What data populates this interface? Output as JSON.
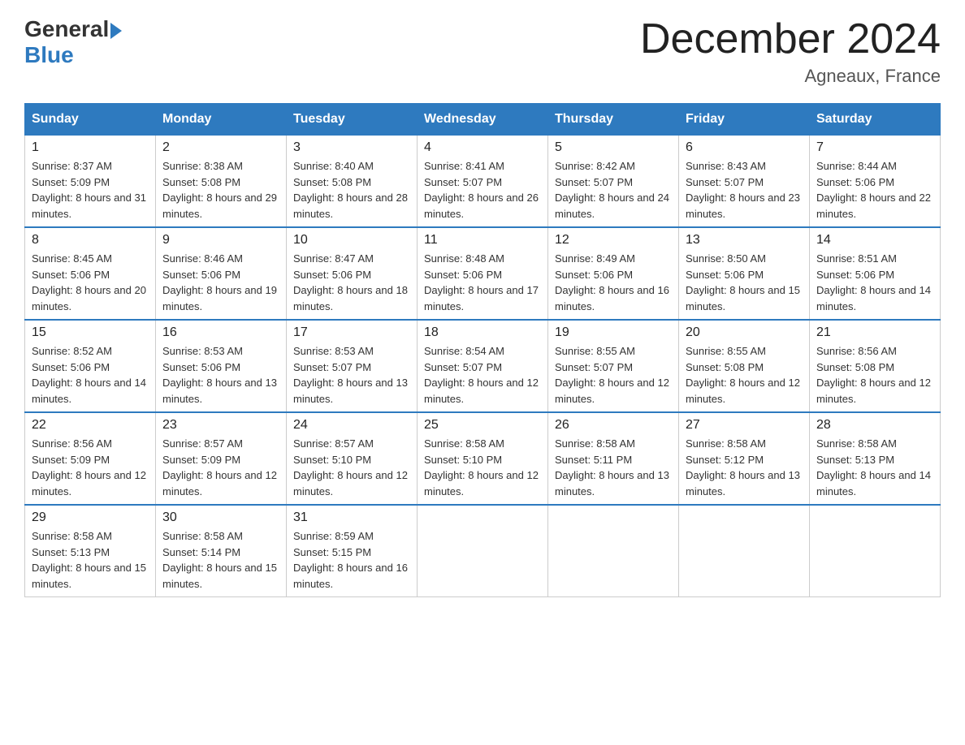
{
  "header": {
    "logo_general": "General",
    "logo_blue": "Blue",
    "month_title": "December 2024",
    "location": "Agneaux, France"
  },
  "weekdays": [
    "Sunday",
    "Monday",
    "Tuesday",
    "Wednesday",
    "Thursday",
    "Friday",
    "Saturday"
  ],
  "weeks": [
    [
      {
        "day": "1",
        "sunrise": "8:37 AM",
        "sunset": "5:09 PM",
        "daylight": "8 hours and 31 minutes."
      },
      {
        "day": "2",
        "sunrise": "8:38 AM",
        "sunset": "5:08 PM",
        "daylight": "8 hours and 29 minutes."
      },
      {
        "day": "3",
        "sunrise": "8:40 AM",
        "sunset": "5:08 PM",
        "daylight": "8 hours and 28 minutes."
      },
      {
        "day": "4",
        "sunrise": "8:41 AM",
        "sunset": "5:07 PM",
        "daylight": "8 hours and 26 minutes."
      },
      {
        "day": "5",
        "sunrise": "8:42 AM",
        "sunset": "5:07 PM",
        "daylight": "8 hours and 24 minutes."
      },
      {
        "day": "6",
        "sunrise": "8:43 AM",
        "sunset": "5:07 PM",
        "daylight": "8 hours and 23 minutes."
      },
      {
        "day": "7",
        "sunrise": "8:44 AM",
        "sunset": "5:06 PM",
        "daylight": "8 hours and 22 minutes."
      }
    ],
    [
      {
        "day": "8",
        "sunrise": "8:45 AM",
        "sunset": "5:06 PM",
        "daylight": "8 hours and 20 minutes."
      },
      {
        "day": "9",
        "sunrise": "8:46 AM",
        "sunset": "5:06 PM",
        "daylight": "8 hours and 19 minutes."
      },
      {
        "day": "10",
        "sunrise": "8:47 AM",
        "sunset": "5:06 PM",
        "daylight": "8 hours and 18 minutes."
      },
      {
        "day": "11",
        "sunrise": "8:48 AM",
        "sunset": "5:06 PM",
        "daylight": "8 hours and 17 minutes."
      },
      {
        "day": "12",
        "sunrise": "8:49 AM",
        "sunset": "5:06 PM",
        "daylight": "8 hours and 16 minutes."
      },
      {
        "day": "13",
        "sunrise": "8:50 AM",
        "sunset": "5:06 PM",
        "daylight": "8 hours and 15 minutes."
      },
      {
        "day": "14",
        "sunrise": "8:51 AM",
        "sunset": "5:06 PM",
        "daylight": "8 hours and 14 minutes."
      }
    ],
    [
      {
        "day": "15",
        "sunrise": "8:52 AM",
        "sunset": "5:06 PM",
        "daylight": "8 hours and 14 minutes."
      },
      {
        "day": "16",
        "sunrise": "8:53 AM",
        "sunset": "5:06 PM",
        "daylight": "8 hours and 13 minutes."
      },
      {
        "day": "17",
        "sunrise": "8:53 AM",
        "sunset": "5:07 PM",
        "daylight": "8 hours and 13 minutes."
      },
      {
        "day": "18",
        "sunrise": "8:54 AM",
        "sunset": "5:07 PM",
        "daylight": "8 hours and 12 minutes."
      },
      {
        "day": "19",
        "sunrise": "8:55 AM",
        "sunset": "5:07 PM",
        "daylight": "8 hours and 12 minutes."
      },
      {
        "day": "20",
        "sunrise": "8:55 AM",
        "sunset": "5:08 PM",
        "daylight": "8 hours and 12 minutes."
      },
      {
        "day": "21",
        "sunrise": "8:56 AM",
        "sunset": "5:08 PM",
        "daylight": "8 hours and 12 minutes."
      }
    ],
    [
      {
        "day": "22",
        "sunrise": "8:56 AM",
        "sunset": "5:09 PM",
        "daylight": "8 hours and 12 minutes."
      },
      {
        "day": "23",
        "sunrise": "8:57 AM",
        "sunset": "5:09 PM",
        "daylight": "8 hours and 12 minutes."
      },
      {
        "day": "24",
        "sunrise": "8:57 AM",
        "sunset": "5:10 PM",
        "daylight": "8 hours and 12 minutes."
      },
      {
        "day": "25",
        "sunrise": "8:58 AM",
        "sunset": "5:10 PM",
        "daylight": "8 hours and 12 minutes."
      },
      {
        "day": "26",
        "sunrise": "8:58 AM",
        "sunset": "5:11 PM",
        "daylight": "8 hours and 13 minutes."
      },
      {
        "day": "27",
        "sunrise": "8:58 AM",
        "sunset": "5:12 PM",
        "daylight": "8 hours and 13 minutes."
      },
      {
        "day": "28",
        "sunrise": "8:58 AM",
        "sunset": "5:13 PM",
        "daylight": "8 hours and 14 minutes."
      }
    ],
    [
      {
        "day": "29",
        "sunrise": "8:58 AM",
        "sunset": "5:13 PM",
        "daylight": "8 hours and 15 minutes."
      },
      {
        "day": "30",
        "sunrise": "8:58 AM",
        "sunset": "5:14 PM",
        "daylight": "8 hours and 15 minutes."
      },
      {
        "day": "31",
        "sunrise": "8:59 AM",
        "sunset": "5:15 PM",
        "daylight": "8 hours and 16 minutes."
      },
      null,
      null,
      null,
      null
    ]
  ]
}
